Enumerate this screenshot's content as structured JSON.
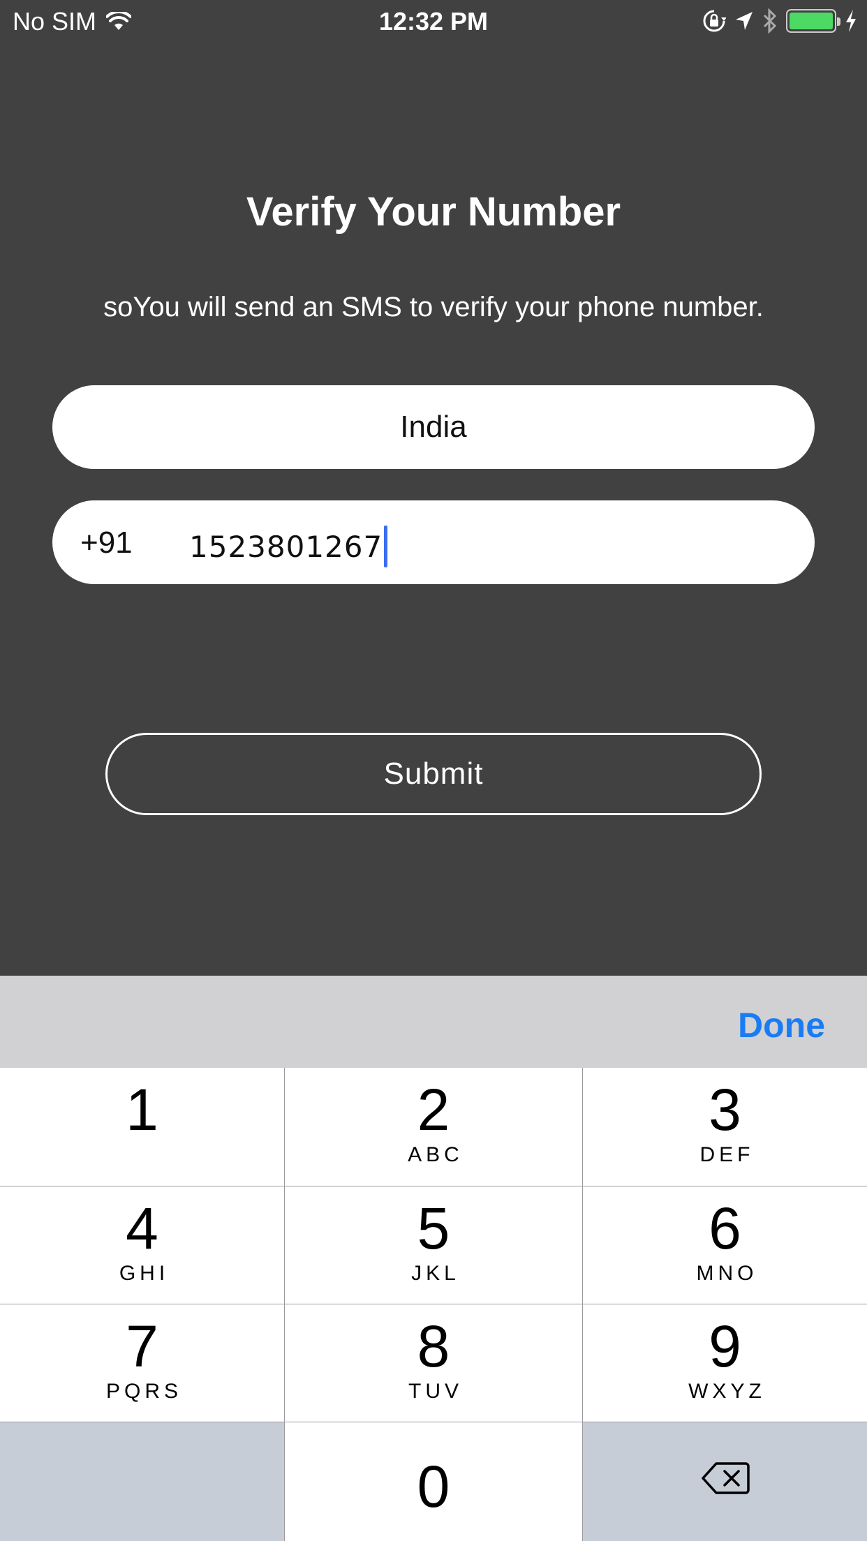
{
  "status_bar": {
    "carrier": "No SIM",
    "time": "12:32 PM",
    "icons": [
      "wifi-icon",
      "orientation-lock-icon",
      "location-arrow-icon",
      "bluetooth-icon",
      "battery-icon",
      "charging-bolt-icon"
    ],
    "battery_color": "#4cd964"
  },
  "screen": {
    "title": "Verify Your Number",
    "subtitle": "soYou will send an SMS to verify your phone number."
  },
  "form": {
    "country": "India",
    "dial_code": "+91",
    "phone_number": "1523801267",
    "submit_label": "Submit"
  },
  "keyboard": {
    "done_label": "Done",
    "accent_color": "#1a7cf4",
    "keys": [
      {
        "digit": "1",
        "letters": ""
      },
      {
        "digit": "2",
        "letters": "ABC"
      },
      {
        "digit": "3",
        "letters": "DEF"
      },
      {
        "digit": "4",
        "letters": "GHI"
      },
      {
        "digit": "5",
        "letters": "JKL"
      },
      {
        "digit": "6",
        "letters": "MNO"
      },
      {
        "digit": "7",
        "letters": "PQRS"
      },
      {
        "digit": "8",
        "letters": "TUV"
      },
      {
        "digit": "9",
        "letters": "WXYZ"
      },
      {
        "digit": "0",
        "letters": ""
      }
    ]
  }
}
